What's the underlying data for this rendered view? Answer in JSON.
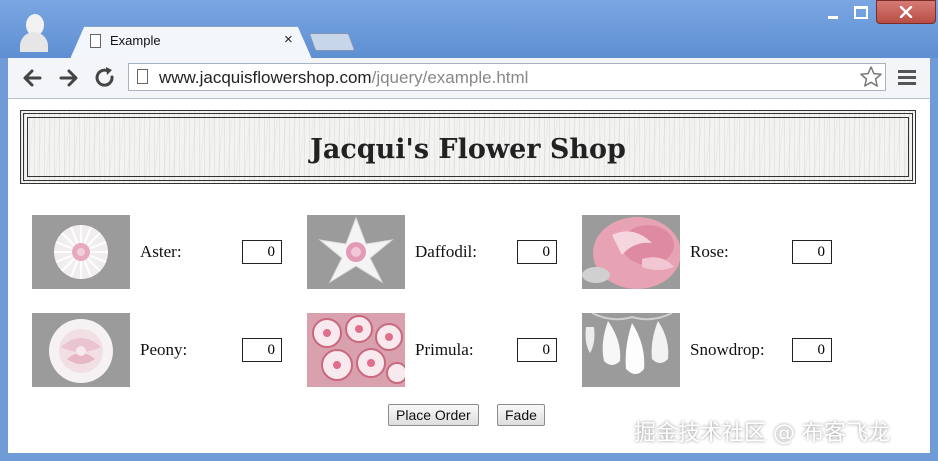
{
  "browser": {
    "tab_title": "Example",
    "tab_close": "×",
    "url_host": "www.jacquisflowershop.com",
    "url_path": "/jquery/example.html",
    "back_icon": "arrow-left-icon",
    "forward_icon": "arrow-right-icon",
    "reload_icon": "reload-icon",
    "star_icon": "star-icon",
    "menu_icon": "menu-icon"
  },
  "page": {
    "title": "Jacqui's Flower Shop",
    "products": [
      {
        "label": "Aster:",
        "quantity": "0",
        "image": "aster-image"
      },
      {
        "label": "Daffodil:",
        "quantity": "0",
        "image": "daffodil-image"
      },
      {
        "label": "Rose:",
        "quantity": "0",
        "image": "rose-image"
      },
      {
        "label": "Peony:",
        "quantity": "0",
        "image": "peony-image"
      },
      {
        "label": "Primula:",
        "quantity": "0",
        "image": "primula-image"
      },
      {
        "label": "Snowdrop:",
        "quantity": "0",
        "image": "snowdrop-image"
      }
    ],
    "buttons": {
      "place_order": "Place Order",
      "fade": "Fade"
    }
  },
  "watermark": "掘金技术社区 @ 布客飞龙",
  "colors": {
    "window_frame": "#6f9bd6",
    "close_button": "#c45a50",
    "header_border": "#333333",
    "thumb_background": "#9b9b9b"
  }
}
